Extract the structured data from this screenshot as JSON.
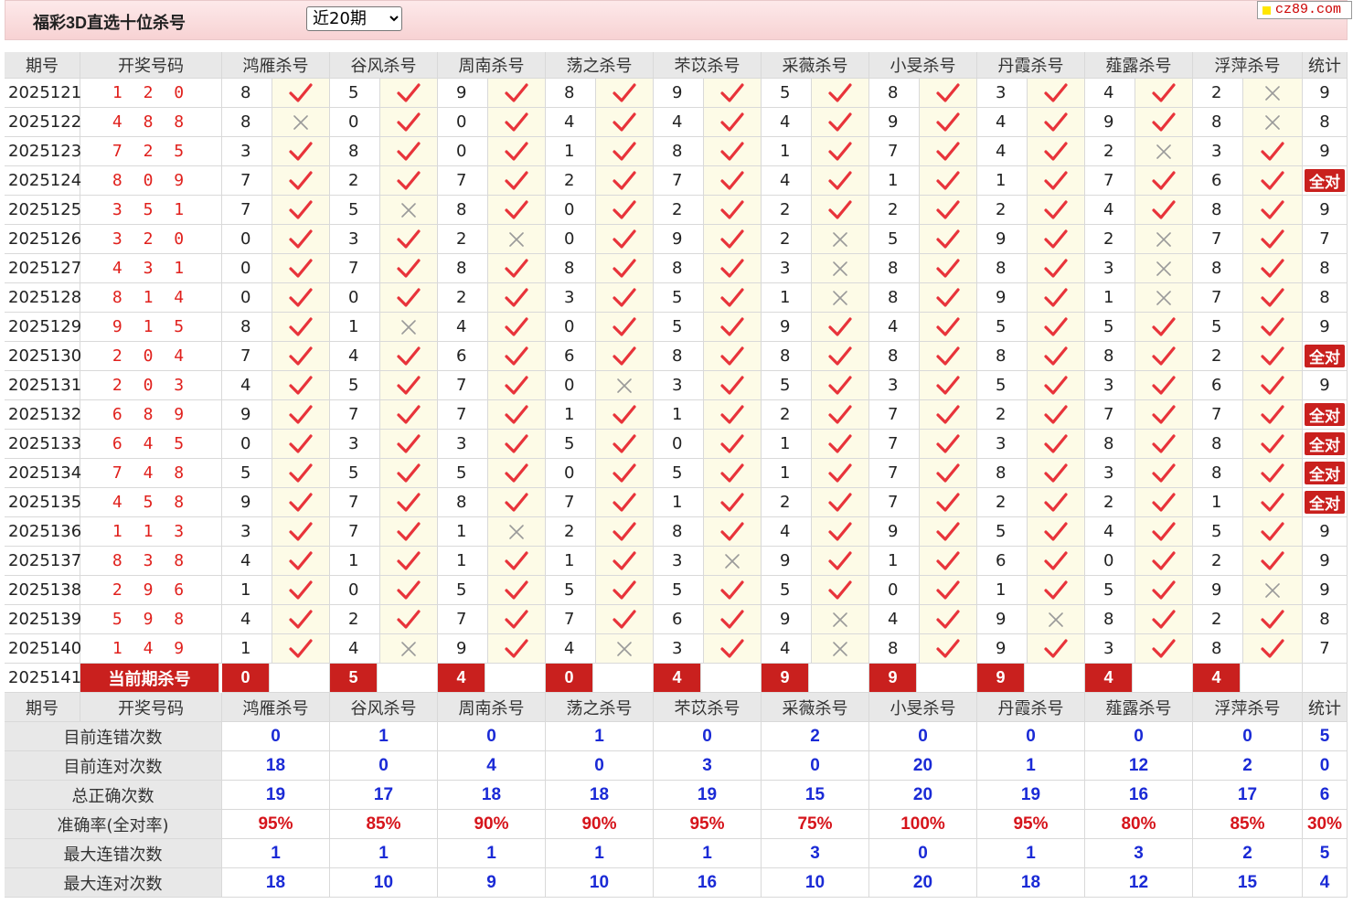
{
  "header": {
    "title": "福彩3D直选十位杀号",
    "period_selected": "近20期",
    "site": "cz89.com"
  },
  "columns": {
    "period": "期号",
    "draw": "开奖号码",
    "predictors": [
      "鸿雁杀号",
      "谷风杀号",
      "周南杀号",
      "荡之杀号",
      "芣苡杀号",
      "采薇杀号",
      "小旻杀号",
      "丹霞杀号",
      "薤露杀号",
      "浮萍杀号"
    ],
    "stat": "统计"
  },
  "icons": {
    "correct": "red-check-icon",
    "wrong": "gray-cross-icon"
  },
  "colors": {
    "accent_red": "#c9201e",
    "draw_red": "#e0201c",
    "stat_blue": "#1a2ad6",
    "mark_bg": "#fdfbe7",
    "header_bg": "#e8e8e8"
  },
  "rows": [
    {
      "period": "2025121",
      "draw": "1 2 0",
      "kills": [
        "8",
        "5",
        "9",
        "8",
        "9",
        "5",
        "8",
        "3",
        "4",
        "2"
      ],
      "ok": [
        1,
        1,
        1,
        1,
        1,
        1,
        1,
        1,
        1,
        0
      ],
      "stat": "9"
    },
    {
      "period": "2025122",
      "draw": "4 8 8",
      "kills": [
        "8",
        "0",
        "0",
        "4",
        "4",
        "4",
        "9",
        "4",
        "9",
        "8"
      ],
      "ok": [
        0,
        1,
        1,
        1,
        1,
        1,
        1,
        1,
        1,
        0
      ],
      "stat": "8"
    },
    {
      "period": "2025123",
      "draw": "7 2 5",
      "kills": [
        "3",
        "8",
        "0",
        "1",
        "8",
        "1",
        "7",
        "4",
        "2",
        "3"
      ],
      "ok": [
        1,
        1,
        1,
        1,
        1,
        1,
        1,
        1,
        0,
        1
      ],
      "stat": "9"
    },
    {
      "period": "2025124",
      "draw": "8 0 9",
      "kills": [
        "7",
        "2",
        "7",
        "2",
        "7",
        "4",
        "1",
        "1",
        "7",
        "6"
      ],
      "ok": [
        1,
        1,
        1,
        1,
        1,
        1,
        1,
        1,
        1,
        1
      ],
      "stat": "全对"
    },
    {
      "period": "2025125",
      "draw": "3 5 1",
      "kills": [
        "7",
        "5",
        "8",
        "0",
        "2",
        "2",
        "2",
        "2",
        "4",
        "8"
      ],
      "ok": [
        1,
        0,
        1,
        1,
        1,
        1,
        1,
        1,
        1,
        1
      ],
      "stat": "9"
    },
    {
      "period": "2025126",
      "draw": "3 2 0",
      "kills": [
        "0",
        "3",
        "2",
        "0",
        "9",
        "2",
        "5",
        "9",
        "2",
        "7"
      ],
      "ok": [
        1,
        1,
        0,
        1,
        1,
        0,
        1,
        1,
        0,
        1
      ],
      "stat": "7"
    },
    {
      "period": "2025127",
      "draw": "4 3 1",
      "kills": [
        "0",
        "7",
        "8",
        "8",
        "8",
        "3",
        "8",
        "8",
        "3",
        "8"
      ],
      "ok": [
        1,
        1,
        1,
        1,
        1,
        0,
        1,
        1,
        0,
        1
      ],
      "stat": "8"
    },
    {
      "period": "2025128",
      "draw": "8 1 4",
      "kills": [
        "0",
        "0",
        "2",
        "3",
        "5",
        "1",
        "8",
        "9",
        "1",
        "7"
      ],
      "ok": [
        1,
        1,
        1,
        1,
        1,
        0,
        1,
        1,
        0,
        1
      ],
      "stat": "8"
    },
    {
      "period": "2025129",
      "draw": "9 1 5",
      "kills": [
        "8",
        "1",
        "4",
        "0",
        "5",
        "9",
        "4",
        "5",
        "5",
        "5"
      ],
      "ok": [
        1,
        0,
        1,
        1,
        1,
        1,
        1,
        1,
        1,
        1
      ],
      "stat": "9"
    },
    {
      "period": "2025130",
      "draw": "2 0 4",
      "kills": [
        "7",
        "4",
        "6",
        "6",
        "8",
        "8",
        "8",
        "8",
        "8",
        "2"
      ],
      "ok": [
        1,
        1,
        1,
        1,
        1,
        1,
        1,
        1,
        1,
        1
      ],
      "stat": "全对"
    },
    {
      "period": "2025131",
      "draw": "2 0 3",
      "kills": [
        "4",
        "5",
        "7",
        "0",
        "3",
        "5",
        "3",
        "5",
        "3",
        "6"
      ],
      "ok": [
        1,
        1,
        1,
        0,
        1,
        1,
        1,
        1,
        1,
        1
      ],
      "stat": "9"
    },
    {
      "period": "2025132",
      "draw": "6 8 9",
      "kills": [
        "9",
        "7",
        "7",
        "1",
        "1",
        "2",
        "7",
        "2",
        "7",
        "7"
      ],
      "ok": [
        1,
        1,
        1,
        1,
        1,
        1,
        1,
        1,
        1,
        1
      ],
      "stat": "全对"
    },
    {
      "period": "2025133",
      "draw": "6 4 5",
      "kills": [
        "0",
        "3",
        "3",
        "5",
        "0",
        "1",
        "7",
        "3",
        "8",
        "8"
      ],
      "ok": [
        1,
        1,
        1,
        1,
        1,
        1,
        1,
        1,
        1,
        1
      ],
      "stat": "全对"
    },
    {
      "period": "2025134",
      "draw": "7 4 8",
      "kills": [
        "5",
        "5",
        "5",
        "0",
        "5",
        "1",
        "7",
        "8",
        "3",
        "8"
      ],
      "ok": [
        1,
        1,
        1,
        1,
        1,
        1,
        1,
        1,
        1,
        1
      ],
      "stat": "全对"
    },
    {
      "period": "2025135",
      "draw": "4 5 8",
      "kills": [
        "9",
        "7",
        "8",
        "7",
        "1",
        "2",
        "7",
        "2",
        "2",
        "1"
      ],
      "ok": [
        1,
        1,
        1,
        1,
        1,
        1,
        1,
        1,
        1,
        1
      ],
      "stat": "全对"
    },
    {
      "period": "2025136",
      "draw": "1 1 3",
      "kills": [
        "3",
        "7",
        "1",
        "2",
        "8",
        "4",
        "9",
        "5",
        "4",
        "5"
      ],
      "ok": [
        1,
        1,
        0,
        1,
        1,
        1,
        1,
        1,
        1,
        1
      ],
      "stat": "9"
    },
    {
      "period": "2025137",
      "draw": "8 3 8",
      "kills": [
        "4",
        "1",
        "1",
        "1",
        "3",
        "9",
        "1",
        "6",
        "0",
        "2"
      ],
      "ok": [
        1,
        1,
        1,
        1,
        0,
        1,
        1,
        1,
        1,
        1
      ],
      "stat": "9"
    },
    {
      "period": "2025138",
      "draw": "2 9 6",
      "kills": [
        "1",
        "0",
        "5",
        "5",
        "5",
        "5",
        "0",
        "1",
        "5",
        "9"
      ],
      "ok": [
        1,
        1,
        1,
        1,
        1,
        1,
        1,
        1,
        1,
        0
      ],
      "stat": "9"
    },
    {
      "period": "2025139",
      "draw": "5 9 8",
      "kills": [
        "4",
        "2",
        "7",
        "7",
        "6",
        "9",
        "4",
        "9",
        "8",
        "2"
      ],
      "ok": [
        1,
        1,
        1,
        1,
        1,
        0,
        1,
        0,
        1,
        1
      ],
      "stat": "8"
    },
    {
      "period": "2025140",
      "draw": "1 4 9",
      "kills": [
        "1",
        "4",
        "9",
        "4",
        "3",
        "4",
        "8",
        "9",
        "3",
        "8"
      ],
      "ok": [
        1,
        0,
        1,
        0,
        1,
        0,
        1,
        1,
        1,
        1
      ],
      "stat": "7"
    }
  ],
  "current": {
    "period": "2025141",
    "label": "当前期杀号",
    "kills": [
      "0",
      "5",
      "4",
      "0",
      "4",
      "9",
      "9",
      "9",
      "4",
      "4"
    ]
  },
  "stats": [
    {
      "label": "目前连错次数",
      "values": [
        "0",
        "1",
        "0",
        "1",
        "0",
        "2",
        "0",
        "0",
        "0",
        "0"
      ],
      "stat": "5",
      "red": false
    },
    {
      "label": "目前连对次数",
      "values": [
        "18",
        "0",
        "4",
        "0",
        "3",
        "0",
        "20",
        "1",
        "12",
        "2"
      ],
      "stat": "0",
      "red": false
    },
    {
      "label": "总正确次数",
      "values": [
        "19",
        "17",
        "18",
        "18",
        "19",
        "15",
        "20",
        "19",
        "16",
        "17"
      ],
      "stat": "6",
      "red": false
    },
    {
      "label": "准确率(全对率)",
      "values": [
        "95%",
        "85%",
        "90%",
        "90%",
        "95%",
        "75%",
        "100%",
        "95%",
        "80%",
        "85%"
      ],
      "stat": "30%",
      "red": true
    },
    {
      "label": "最大连错次数",
      "values": [
        "1",
        "1",
        "1",
        "1",
        "1",
        "3",
        "0",
        "1",
        "3",
        "2"
      ],
      "stat": "5",
      "red": false
    },
    {
      "label": "最大连对次数",
      "values": [
        "18",
        "10",
        "9",
        "10",
        "16",
        "10",
        "20",
        "18",
        "12",
        "15"
      ],
      "stat": "4",
      "red": false
    }
  ]
}
